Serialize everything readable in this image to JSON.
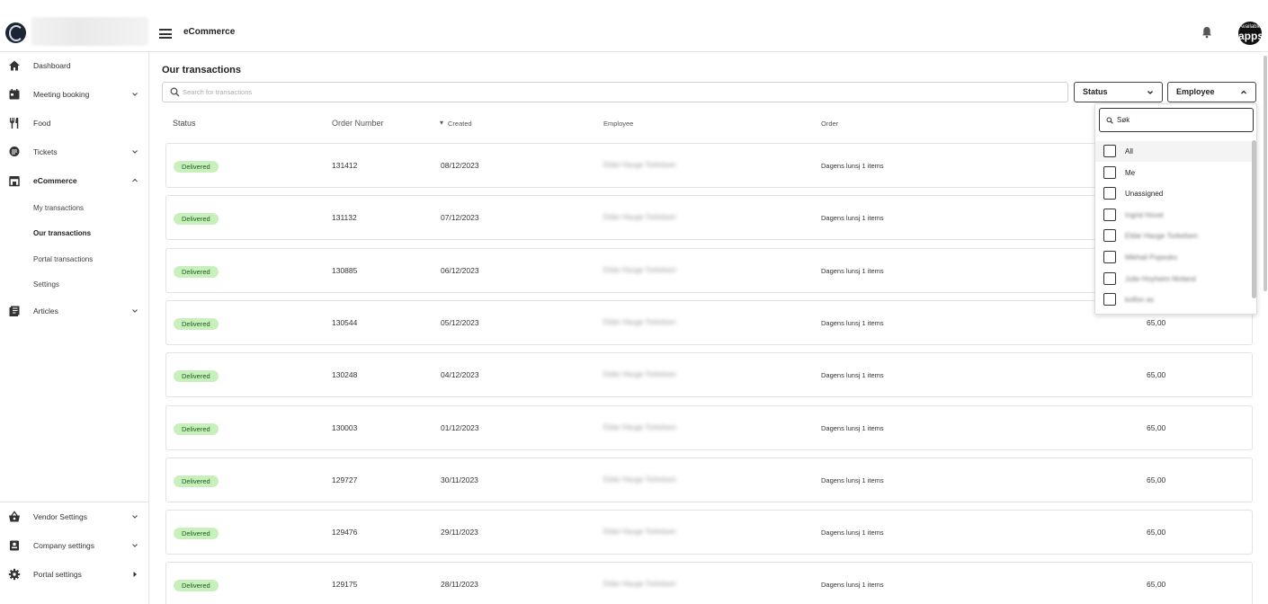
{
  "app": {
    "section_title": "eCommerce",
    "avatar_line1": "Available",
    "avatar_line2": "apps"
  },
  "sidebar": {
    "items": [
      {
        "label": "Dashboard",
        "icon": "home-icon"
      },
      {
        "label": "Meeting booking",
        "icon": "calendar-icon"
      },
      {
        "label": "Food",
        "icon": "cutlery-icon"
      },
      {
        "label": "Tickets",
        "icon": "chat-bubble-icon"
      },
      {
        "label": "eCommerce",
        "icon": "storefront-icon"
      },
      {
        "label": "Articles",
        "icon": "articles-icon"
      }
    ],
    "ecommerce_sub": [
      "My transactions",
      "Our transactions",
      "Portal transactions",
      "Settings"
    ],
    "bottom_items": [
      {
        "label": "Vendor Settings",
        "icon": "basket-icon"
      },
      {
        "label": "Company settings",
        "icon": "badge-icon"
      },
      {
        "label": "Portal settings",
        "icon": "gear-icon"
      }
    ]
  },
  "main": {
    "title": "Our transactions",
    "search_placeholder": "Search for transactions",
    "filters": {
      "status_label": "Status",
      "employee_label": "Employee"
    }
  },
  "table": {
    "headers": {
      "status": "Status",
      "order_number": "Order Number",
      "created": "Created",
      "employee": "Employee",
      "order": "Order"
    },
    "rows": [
      {
        "status": "Delivered",
        "order_number": "131412",
        "created": "08/12/2023",
        "employee": "Eldar Hauge Torkelsen",
        "order": "Dagens lunsj 1 items",
        "amount": ""
      },
      {
        "status": "Delivered",
        "order_number": "131132",
        "created": "07/12/2023",
        "employee": "Eldar Hauge Torkelsen",
        "order": "Dagens lunsj 1 items",
        "amount": ""
      },
      {
        "status": "Delivered",
        "order_number": "130885",
        "created": "06/12/2023",
        "employee": "Eldar Hauge Torkelsen",
        "order": "Dagens lunsj 1 items",
        "amount": ""
      },
      {
        "status": "Delivered",
        "order_number": "130544",
        "created": "05/12/2023",
        "employee": "Eldar Hauge Torkelsen",
        "order": "Dagens lunsj 1 items",
        "amount": "65,00"
      },
      {
        "status": "Delivered",
        "order_number": "130248",
        "created": "04/12/2023",
        "employee": "Eldar Hauge Torkelsen",
        "order": "Dagens lunsj 1 items",
        "amount": "65,00"
      },
      {
        "status": "Delivered",
        "order_number": "130003",
        "created": "01/12/2023",
        "employee": "Eldar Hauge Torkelsen",
        "order": "Dagens lunsj 1 items",
        "amount": "65,00"
      },
      {
        "status": "Delivered",
        "order_number": "129727",
        "created": "30/11/2023",
        "employee": "Eldar Hauge Torkelsen",
        "order": "Dagens lunsj 1 items",
        "amount": "65,00"
      },
      {
        "status": "Delivered",
        "order_number": "129476",
        "created": "29/11/2023",
        "employee": "Eldar Hauge Torkelsen",
        "order": "Dagens lunsj 1 items",
        "amount": "65,00"
      },
      {
        "status": "Delivered",
        "order_number": "129175",
        "created": "28/11/2023",
        "employee": "Eldar Hauge Torkelsen",
        "order": "Dagens lunsj 1 items",
        "amount": "65,00"
      }
    ]
  },
  "employee_dropdown": {
    "search_value": "Søk",
    "options": [
      "All",
      "Me",
      "Unassigned",
      "Ingrid Hovel",
      "Eldar Hauge Torkelsen",
      "Mikhail Popesko",
      "Julie Hoyheim Moland",
      "kolfon as"
    ]
  },
  "colors": {
    "badge_bg": "#c8f0bc",
    "badge_text": "#1d5c1d",
    "sidebar_border": "#e4e4e4"
  }
}
